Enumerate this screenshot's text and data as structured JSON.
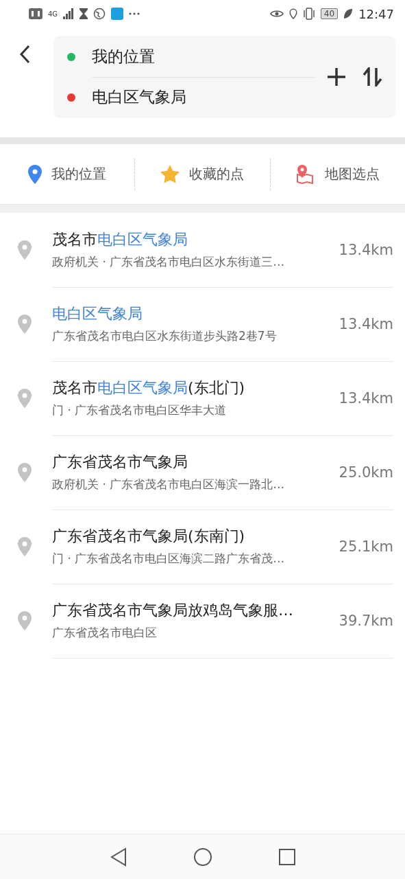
{
  "status_bar": {
    "network": "4G",
    "battery": "40",
    "time": "12:47"
  },
  "route": {
    "start": "我的位置",
    "end": "电白区气象局"
  },
  "shortcuts": [
    {
      "kind": "location",
      "label": "我的位置"
    },
    {
      "kind": "favorite",
      "label": "收藏的点"
    },
    {
      "kind": "map",
      "label": "地图选点"
    }
  ],
  "results": [
    {
      "title": [
        {
          "text": "茂名市",
          "highlight": false
        },
        {
          "text": "电白区气象局",
          "highlight": true
        }
      ],
      "address": "政府机关 · 广东省茂名市电白区水东街道三…",
      "distance": "13.4km"
    },
    {
      "title": [
        {
          "text": "电白区气象局",
          "highlight": true
        }
      ],
      "address": "广东省茂名市电白区水东街道步头路2巷7号",
      "distance": "13.4km"
    },
    {
      "title": [
        {
          "text": "茂名市",
          "highlight": false
        },
        {
          "text": "电白区气象局",
          "highlight": true
        },
        {
          "text": "(东北门)",
          "highlight": false
        }
      ],
      "address": "门 · 广东省茂名市电白区华丰大道",
      "distance": "13.4km"
    },
    {
      "title": [
        {
          "text": "广东省茂名市气象局",
          "highlight": false
        }
      ],
      "address": "政府机关 · 广东省茂名市电白区海滨一路北…",
      "distance": "25.0km"
    },
    {
      "title": [
        {
          "text": "广东省茂名市气象局(东南门)",
          "highlight": false
        }
      ],
      "address": "门 · 广东省茂名市电白区海滨二路广东省茂…",
      "distance": "25.1km"
    },
    {
      "title": [
        {
          "text": "广东省茂名市气象局放鸡岛气象服…",
          "highlight": false
        }
      ],
      "address": "广东省茂名市电白区",
      "distance": "39.7km"
    }
  ]
}
